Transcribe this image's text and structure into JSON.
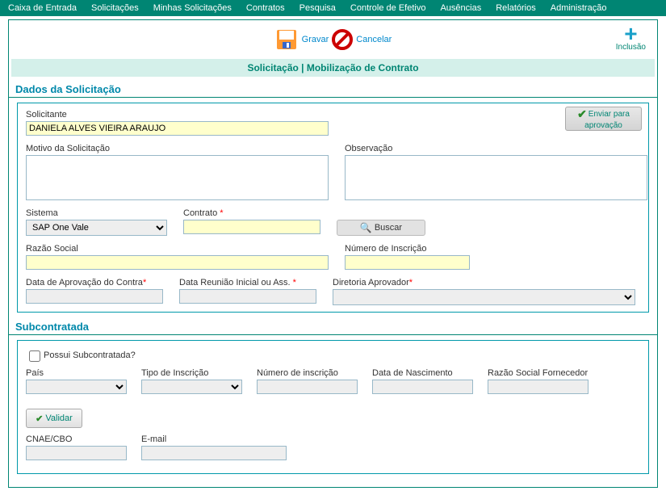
{
  "menu": {
    "items": [
      "Caixa de Entrada",
      "Solicitações",
      "Minhas Solicitações",
      "Contratos",
      "Pesquisa",
      "Controle de Efetivo",
      "Ausências",
      "Relatórios",
      "Administração"
    ]
  },
  "toolbar": {
    "save_label": "Gravar",
    "cancel_label": "Cancelar",
    "include_label": "Inclusão"
  },
  "page_title": "Solicitação | Mobilização de Contrato",
  "sections": {
    "dados_header": "Dados da Solicitação",
    "sub_header": "Subcontratada"
  },
  "labels": {
    "solicitante": "Solicitante",
    "motivo": "Motivo da Solicitação",
    "observacao": "Observação",
    "sistema": "Sistema",
    "contrato": "Contrato",
    "razao": "Razão Social",
    "inscricao": "Número de Inscrição",
    "data_aprov": "Data de Aprovação do Contra",
    "data_reuniao": "Data Reunião Inicial ou Ass.",
    "diretoria": "Diretoria Aprovador",
    "possui_sub": "Possui Subcontratada?",
    "pais": "País",
    "tipo_inscr": "Tipo de Inscrição",
    "num_inscr": "Número de inscrição",
    "data_nasc": "Data de Nascimento",
    "razao_forn": "Razão Social Fornecedor",
    "cnae": "CNAE/CBO",
    "email": "E-mail"
  },
  "values": {
    "solicitante_val": "DANIELA ALVES VIEIRA ARAUJO",
    "sistema_val": "SAP One Vale"
  },
  "buttons": {
    "buscar": "Buscar",
    "enviar_line1": "Enviar para",
    "enviar_line2": "aprovação",
    "validar": "Validar"
  },
  "asterisk": "*"
}
